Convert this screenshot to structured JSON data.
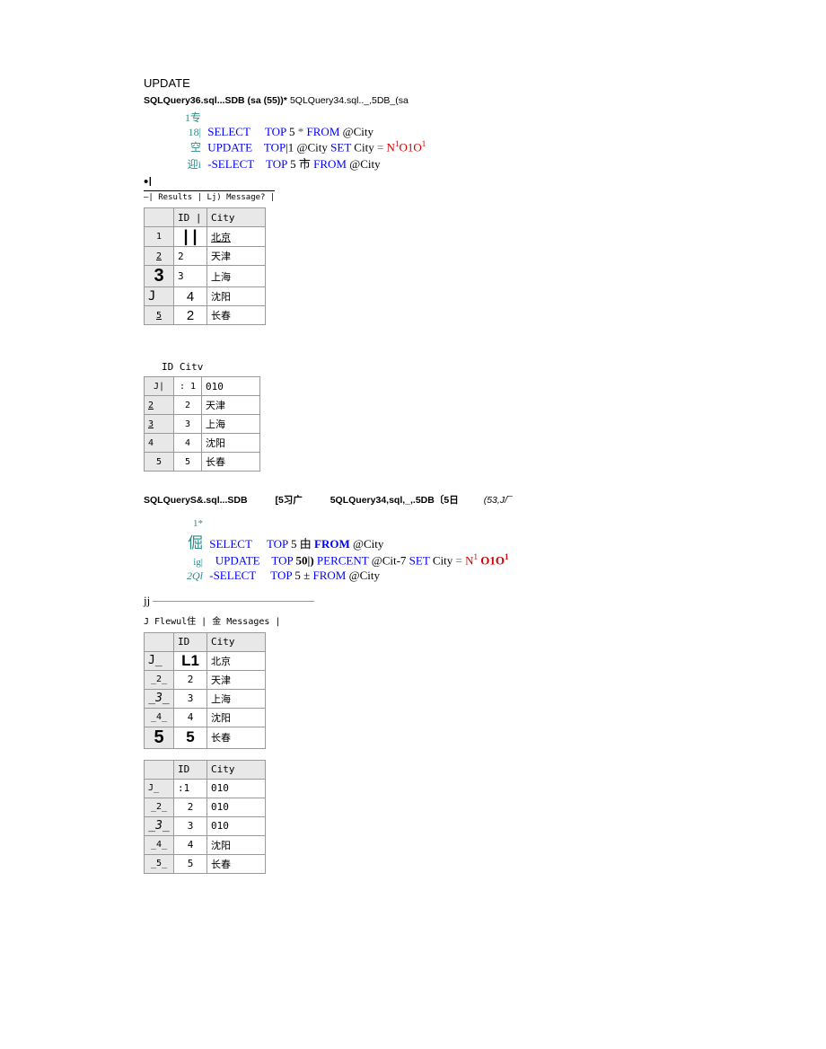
{
  "heading": "UPDATE",
  "tabs1": {
    "active": "SQLQuery36.sql...SDB (sa (55))*",
    "inactive": "5QLQuery34.sql.._,5DB_(sa"
  },
  "code1": {
    "ln1_margin": "1专",
    "ln2_margin": "18|",
    "ln2_t1": "SELECT",
    "ln2_t2": "TOP",
    "ln2_t3": "5",
    "ln2_t4": "*",
    "ln2_t5": "FROM",
    "ln2_t6": "@City",
    "ln3_margin": "空",
    "ln3_t1": "UPDATE",
    "ln3_t2": "TOP",
    "ln3_t3": "|1 @City",
    "ln3_t4": "SET",
    "ln3_t5": "City",
    "ln3_eq": "=",
    "ln3_t6": "N",
    "ln3_sup1": "1",
    "ln3_t7": "O1O",
    "ln3_sup2": "1",
    "ln4_margin": "迎i",
    "ln4_t1": "-SELECT",
    "ln4_t2": "TOP",
    "ln4_t3": "5",
    "ln4_t4": "市",
    "ln4_t5": "FROM",
    "ln4_t6": "@City"
  },
  "cursor": "•I",
  "restabs1": "—| Results | Lj) Message? |",
  "table1": {
    "hdr": [
      "",
      "ID |",
      "City"
    ],
    "rows": [
      {
        "r": "1",
        "id": "| |",
        "city": "北京",
        "big": true
      },
      {
        "r": "2",
        "id": "2",
        "city": "天津"
      },
      {
        "r": "3",
        "id": "3",
        "city": "上海",
        "bigrow": true
      },
      {
        "r": "J",
        "id": "4",
        "city": "沈阳",
        "medid": true
      },
      {
        "r": "5",
        "id": "2",
        "city": "长春",
        "medid": true
      }
    ]
  },
  "table2hdr": "ID Citv",
  "table2": {
    "rows": [
      {
        "r": "J|",
        "id": ": 1",
        "city": "010"
      },
      {
        "r": "2",
        "id": "2",
        "city": "天津"
      },
      {
        "r": "3",
        "id": "3",
        "city": "上海"
      },
      {
        "r": "4",
        "id": "4",
        "city": "沈阳"
      },
      {
        "r": "5",
        "id": "5",
        "city": "长春"
      }
    ]
  },
  "tabs2": {
    "t1": "SQLQueryS&.sql...SDB",
    "t2": "[5习广",
    "t3": "5QLQuery34,sql,_,.5DB〔5日",
    "t3i": "(53,J/¯"
  },
  "code2": {
    "ln1_margin": "1*",
    "ln2_margin": "倔",
    "ln2_t1": "SELECT",
    "ln2_t2": "TOP",
    "ln2_t3": "5 由",
    "ln2_t5": "FROM",
    "ln2_t6": "@City",
    "ln3_margin": "ig|",
    "ln3_t1": "UPDATE",
    "ln3_t2": "TOP",
    "ln3_t3": "50|)",
    "ln3_t4": "PERCENT",
    "ln3_t5": "@Cit-7",
    "ln3_t6": "SET",
    "ln3_t7": "City",
    "ln3_eq": "=",
    "ln3_t8": "N",
    "ln3_sup1": "1",
    "ln3_t9": " O1O",
    "ln3_sup2": "1",
    "ln4_margin": "2Ql",
    "ln4_t1": "-SELECT",
    "ln4_t2": "TOP",
    "ln4_t3": "5 ±",
    "ln4_t5": "FROM",
    "ln4_t6": "@City"
  },
  "jj": "jj",
  "restabs2": "J Flewul住 | 金 Messages |",
  "table3": {
    "hdr": [
      "",
      "ID",
      "City"
    ],
    "rows": [
      {
        "r": "J_",
        "id": "L1",
        "city": "北京",
        "bigid": true
      },
      {
        "r": "_2_",
        "id": "2",
        "city": "天津"
      },
      {
        "r": "_3_",
        "id": "3",
        "city": "上海",
        "ital": true
      },
      {
        "r": "_4_",
        "id": "4",
        "city": "沈阳"
      },
      {
        "r": "5",
        "id": "5",
        "city": "长春",
        "bigrow": true
      }
    ]
  },
  "table4": {
    "hdr": [
      "",
      "ID",
      "City"
    ],
    "rows": [
      {
        "r": "J_",
        "id": ":1",
        "city": "010"
      },
      {
        "r": "_2_",
        "id": "2",
        "city": "010"
      },
      {
        "r": "_3_",
        "id": "3",
        "city": "010",
        "ital": true
      },
      {
        "r": "_4_",
        "id": "4",
        "city": "沈阳"
      },
      {
        "r": "_5_",
        "id": "5",
        "city": "长春"
      }
    ]
  }
}
